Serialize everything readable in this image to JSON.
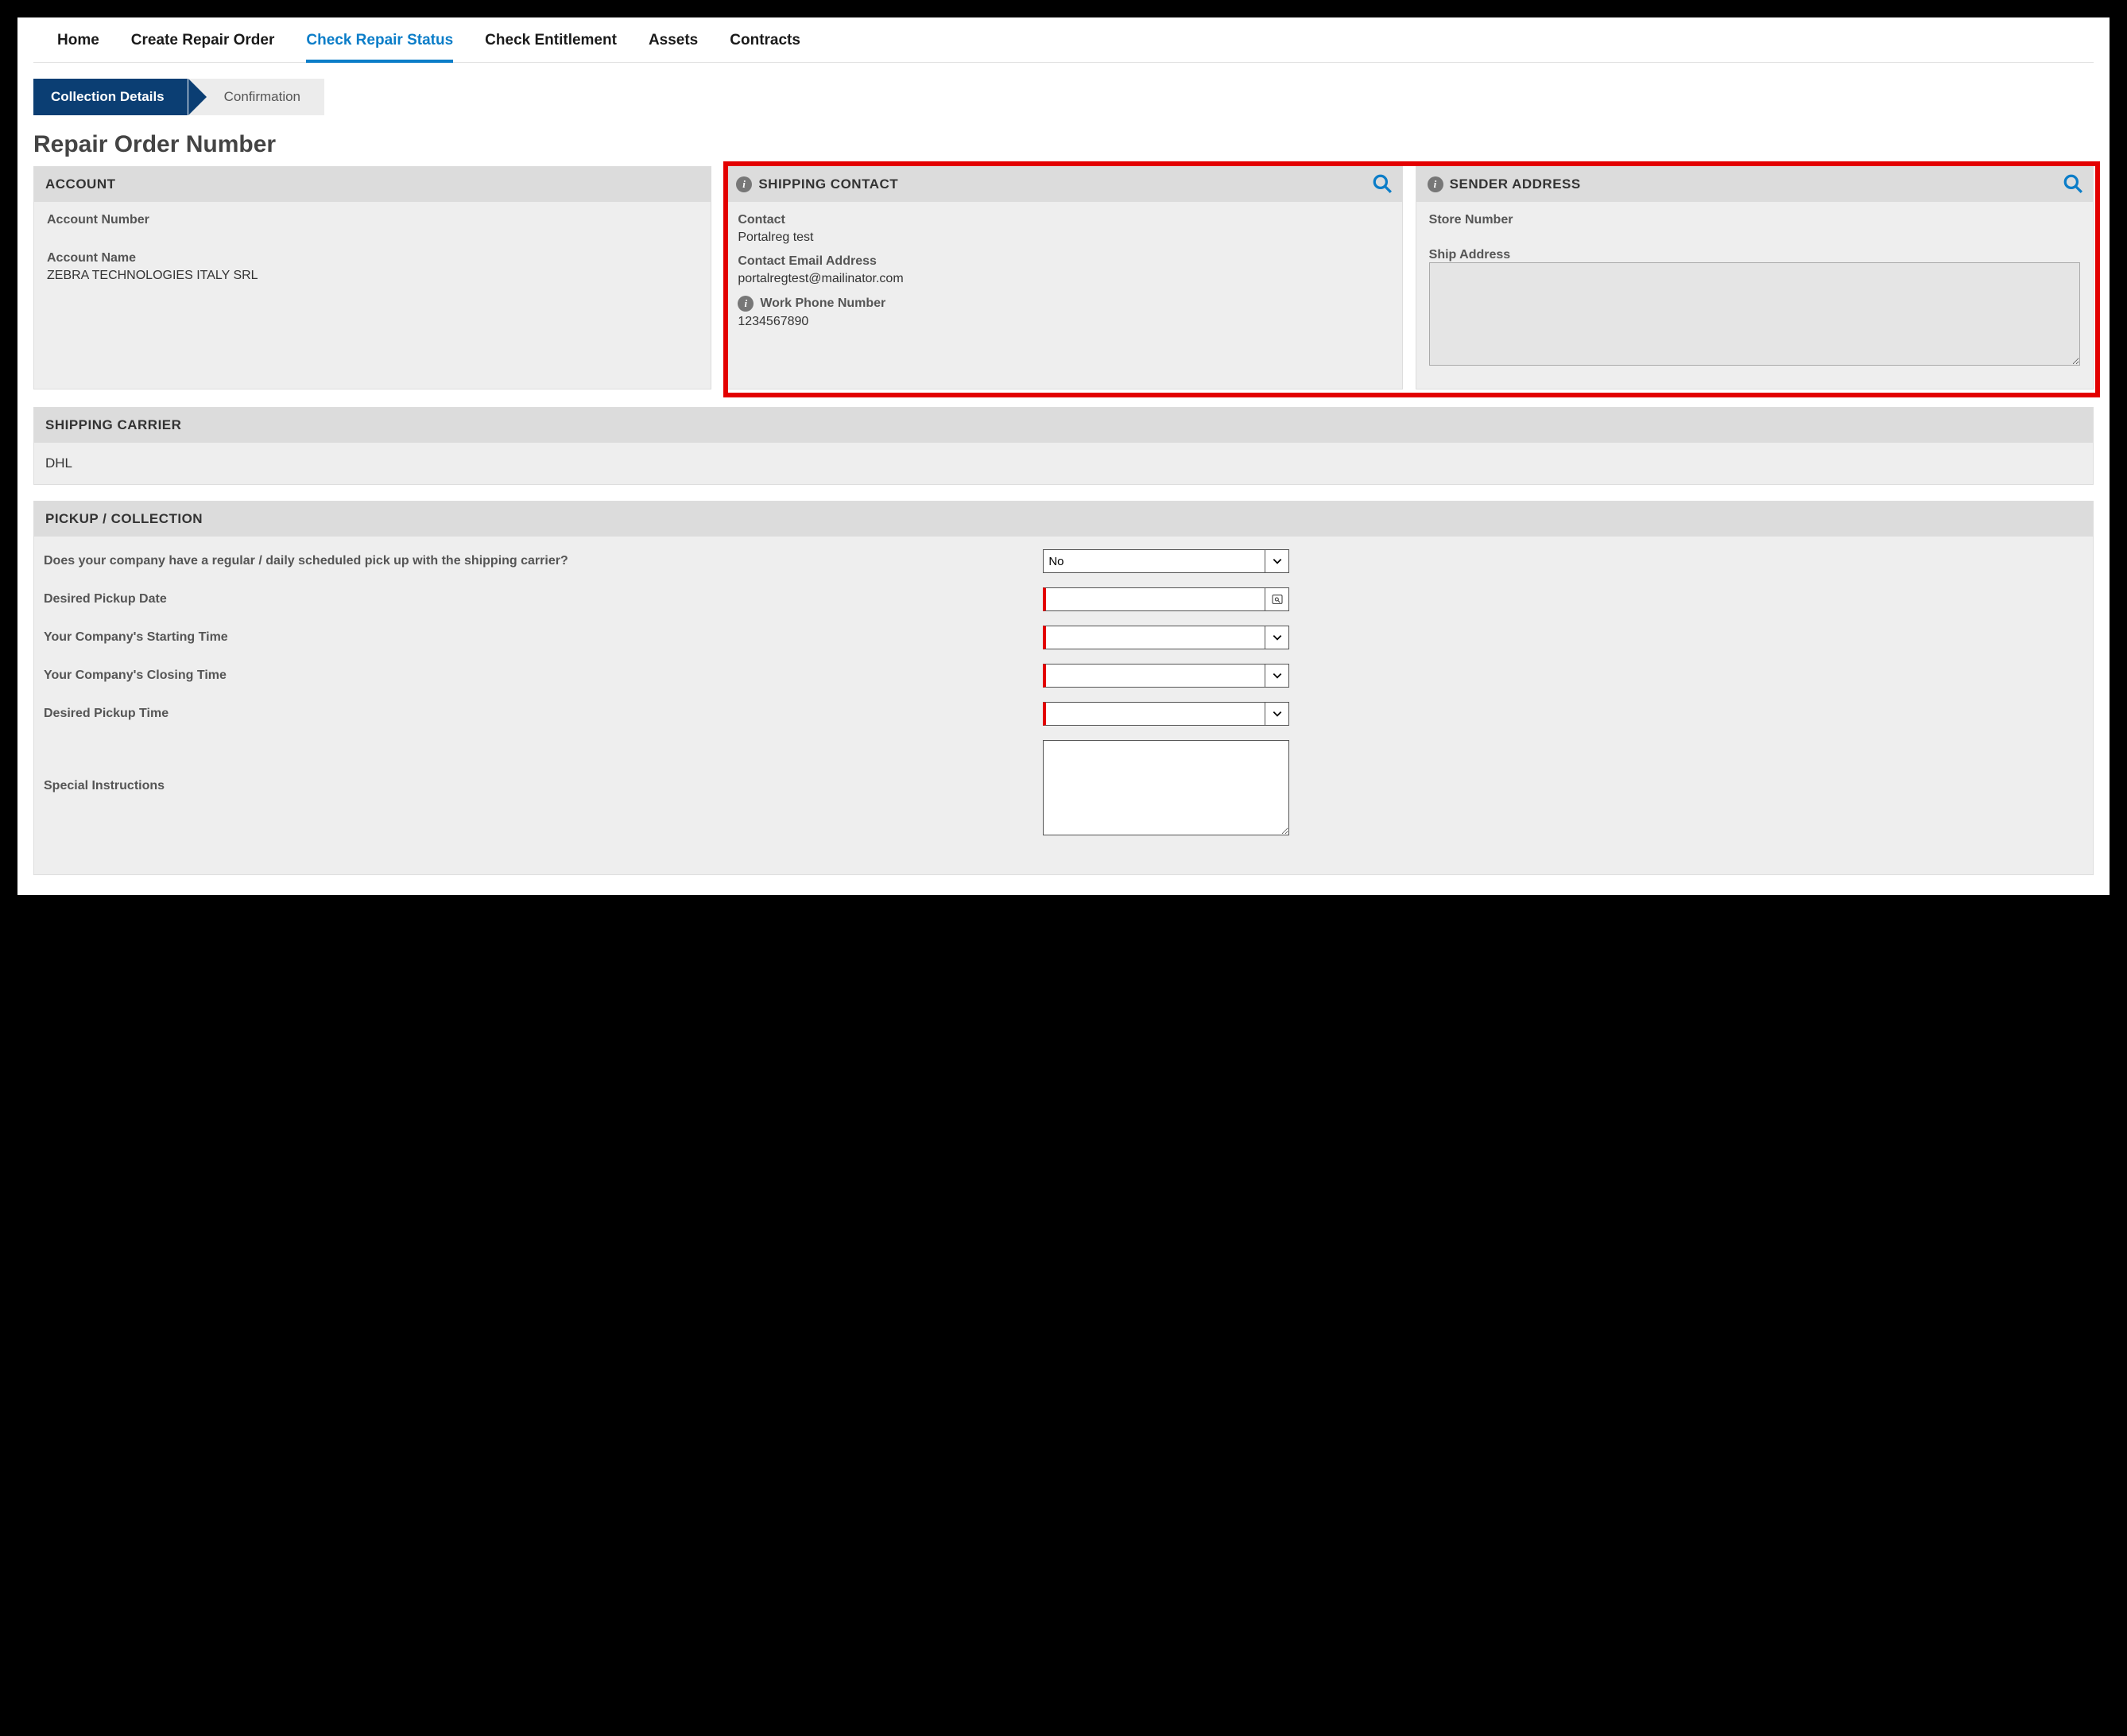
{
  "nav": {
    "home": "Home",
    "create": "Create Repair Order",
    "status": "Check Repair Status",
    "entitlement": "Check Entitlement",
    "assets": "Assets",
    "contracts": "Contracts"
  },
  "steps": {
    "current": "Collection Details",
    "next": "Confirmation"
  },
  "page_title": "Repair Order Number",
  "account": {
    "heading": "ACCOUNT",
    "number_label": "Account Number",
    "number_value": "",
    "name_label": "Account Name",
    "name_value": "ZEBRA TECHNOLOGIES ITALY SRL"
  },
  "shipping_contact": {
    "heading": "SHIPPING CONTACT",
    "contact_label": "Contact",
    "contact_value": "Portalreg test",
    "email_label": "Contact Email Address",
    "email_value": "portalregtest@mailinator.com",
    "phone_label": "Work Phone Number",
    "phone_value": "1234567890"
  },
  "sender_address": {
    "heading": "SENDER ADDRESS",
    "store_label": "Store Number",
    "store_value": "",
    "ship_label": "Ship Address",
    "ship_value": ""
  },
  "carrier": {
    "heading": "SHIPPING CARRIER",
    "value": "DHL"
  },
  "pickup": {
    "heading": "PICKUP / COLLECTION",
    "has_regular_label": "Does your company have a regular / daily scheduled pick up with the shipping carrier?",
    "has_regular_value": "No",
    "date_label": "Desired Pickup Date",
    "date_value": "",
    "start_label": "Your Company's Starting Time",
    "start_value": "",
    "close_label": "Your Company's Closing Time",
    "close_value": "",
    "time_label": "Desired Pickup Time",
    "time_value": "",
    "instr_label": "Special Instructions",
    "instr_value": ""
  }
}
